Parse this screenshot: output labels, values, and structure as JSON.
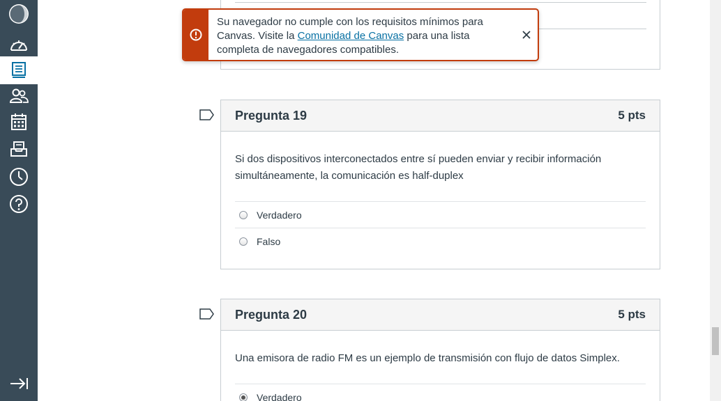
{
  "nav": {
    "items": [
      {
        "icon": "account-avatar-icon"
      },
      {
        "icon": "dashboard-icon"
      },
      {
        "icon": "courses-icon",
        "active": true
      },
      {
        "icon": "groups-icon"
      },
      {
        "icon": "calendar-icon"
      },
      {
        "icon": "inbox-icon"
      },
      {
        "icon": "history-icon"
      },
      {
        "icon": "help-icon"
      }
    ],
    "collapse_icon": "collapse-nav-icon"
  },
  "flash": {
    "text_before": "Su navegador no cumple con los requisitos mínimos para Canvas. Visite la ",
    "link_text": "Comunidad de Canvas",
    "text_after": " para una lista completa de navegadores compatibles.",
    "icon": "warning-icon",
    "close_icon": "close-icon",
    "color": "#c23c0d"
  },
  "questions": [
    {
      "title": "Pregunta 19",
      "points": "5 pts",
      "text": "Si dos dispositivos interconectados entre sí pueden enviar y recibir información simultáneamente, la comunicación es half-duplex",
      "answers": [
        {
          "label": "Verdadero",
          "checked": false
        },
        {
          "label": "Falso",
          "checked": false
        }
      ]
    },
    {
      "title": "Pregunta 20",
      "points": "5 pts",
      "text": "Una emisora de radio FM es un ejemplo de transmisión con flujo de datos Simplex.",
      "answers": [
        {
          "label": "Verdadero",
          "checked": true
        }
      ]
    }
  ]
}
